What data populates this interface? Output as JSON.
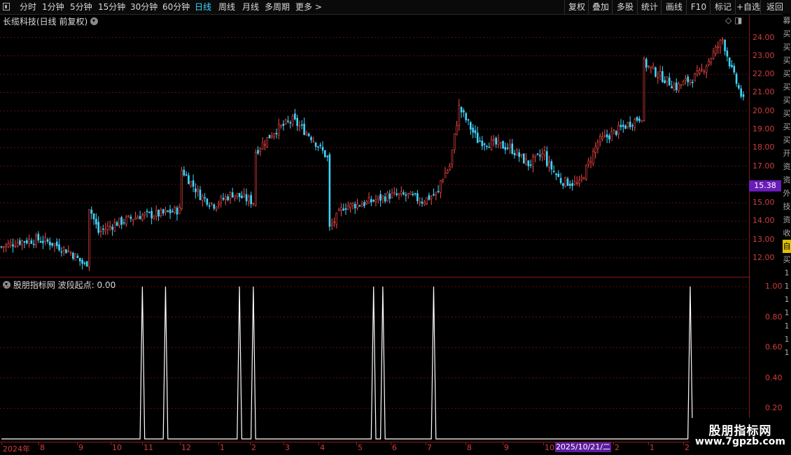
{
  "toolbar": {
    "left_items": [
      "分时",
      "1分钟",
      "5分钟",
      "15分钟",
      "30分钟",
      "60分钟",
      "日线",
      "周线",
      "月线",
      "多周期",
      "更多 >"
    ],
    "active_item": "日线",
    "right_items": [
      "复权",
      "叠加",
      "多股",
      "统计",
      "画线",
      "F10",
      "标记",
      "+自选",
      "返回"
    ]
  },
  "chart_header": {
    "title": "长缆科技(日线 前复权)"
  },
  "indicator_header": {
    "title": "股朋指标网 波段起点: 0.00"
  },
  "price_axis": {
    "labels": [
      "24.00",
      "23.00",
      "22.00",
      "21.00",
      "20.00",
      "19.00",
      "18.00",
      "17.00",
      "16.00",
      "15.00",
      "14.00",
      "13.00",
      "12.00"
    ]
  },
  "current_price": "15.38",
  "indicator_axis": {
    "labels": [
      "1.00",
      "0.80",
      "0.60",
      "0.40",
      "0.20"
    ]
  },
  "x_axis": {
    "labels": [
      "2024年",
      "8",
      "9",
      "10",
      "11",
      "12",
      "1",
      "2",
      "3",
      "4",
      "5",
      "6",
      "7",
      "8",
      "9",
      "10",
      "2025/10/21/二",
      "2",
      "1",
      "2"
    ],
    "cursor_date": "2025/10/21/二"
  },
  "side_strip_chars": [
    "募",
    "买",
    "买",
    "买",
    "买",
    "买",
    "买",
    "买",
    "买",
    "买",
    "开",
    "资",
    "资",
    "外",
    "技",
    "资",
    "收",
    "自",
    "买",
    "1",
    "1",
    "1",
    "1",
    "1",
    "1",
    "1"
  ],
  "watermark": {
    "title": "股朋指标网",
    "url": "www.7gpzb.com"
  },
  "colors": {
    "up": "#ff4a4a",
    "down": "#3fd7ff",
    "indicator": "#ffffff",
    "axis": "#8b1a1a",
    "purple_tag": "#6a1cb8"
  },
  "chart_data": [
    {
      "type": "candlestick",
      "title": "长缆科技(日线 前复权)",
      "ylim": [
        11.2,
        24.9
      ],
      "segments": [
        {
          "n": 38,
          "points": [
            [
              0,
              12.6
            ],
            [
              8,
              12.9
            ],
            [
              16,
              13.0
            ],
            [
              22,
              12.8
            ],
            [
              30,
              12.3
            ],
            [
              36,
              11.6
            ],
            [
              38,
              11.9
            ]
          ]
        },
        {
          "n": 40,
          "points": [
            [
              0,
              14.8
            ],
            [
              4,
              13.4
            ],
            [
              12,
              13.9
            ],
            [
              22,
              14.3
            ],
            [
              32,
              14.4
            ],
            [
              38,
              14.6
            ],
            [
              40,
              14.6
            ]
          ]
        },
        {
          "n": 32,
          "points": [
            [
              0,
              16.8
            ],
            [
              8,
              15.4
            ],
            [
              14,
              14.9
            ],
            [
              22,
              15.5
            ],
            [
              32,
              15.0
            ]
          ]
        },
        {
          "n": 32,
          "points": [
            [
              0,
              17.8
            ],
            [
              8,
              18.9
            ],
            [
              16,
              19.5
            ],
            [
              24,
              18.6
            ],
            [
              32,
              17.3
            ]
          ]
        },
        {
          "n": 48,
          "points": [
            [
              0,
              13.6
            ],
            [
              6,
              14.8
            ],
            [
              16,
              15.0
            ],
            [
              26,
              15.4
            ],
            [
              34,
              15.4
            ],
            [
              40,
              15.1
            ],
            [
              48,
              15.6
            ]
          ]
        },
        {
          "n": 46,
          "points": [
            [
              0,
              16.2
            ],
            [
              4,
              17.0
            ],
            [
              8,
              20.2
            ],
            [
              16,
              18.4
            ],
            [
              30,
              18.0
            ],
            [
              38,
              17.1
            ],
            [
              46,
              17.8
            ]
          ]
        },
        {
          "n": 42,
          "points": [
            [
              0,
              17.2
            ],
            [
              6,
              16.2
            ],
            [
              14,
              16.0
            ],
            [
              22,
              18.3
            ],
            [
              30,
              18.9
            ],
            [
              42,
              19.8
            ]
          ]
        },
        {
          "n": 44,
          "points": [
            [
              0,
              22.6
            ],
            [
              6,
              22.0
            ],
            [
              14,
              21.3
            ],
            [
              24,
              22.0
            ],
            [
              34,
              23.9
            ],
            [
              38,
              22.2
            ],
            [
              44,
              20.2
            ]
          ]
        }
      ]
    },
    {
      "type": "line",
      "series": [
        {
          "name": "波段起点",
          "values": []
        }
      ],
      "spikes_at_px": [],
      "spike_values_note": "",
      "ylim": [
        0,
        1.0
      ]
    }
  ]
}
